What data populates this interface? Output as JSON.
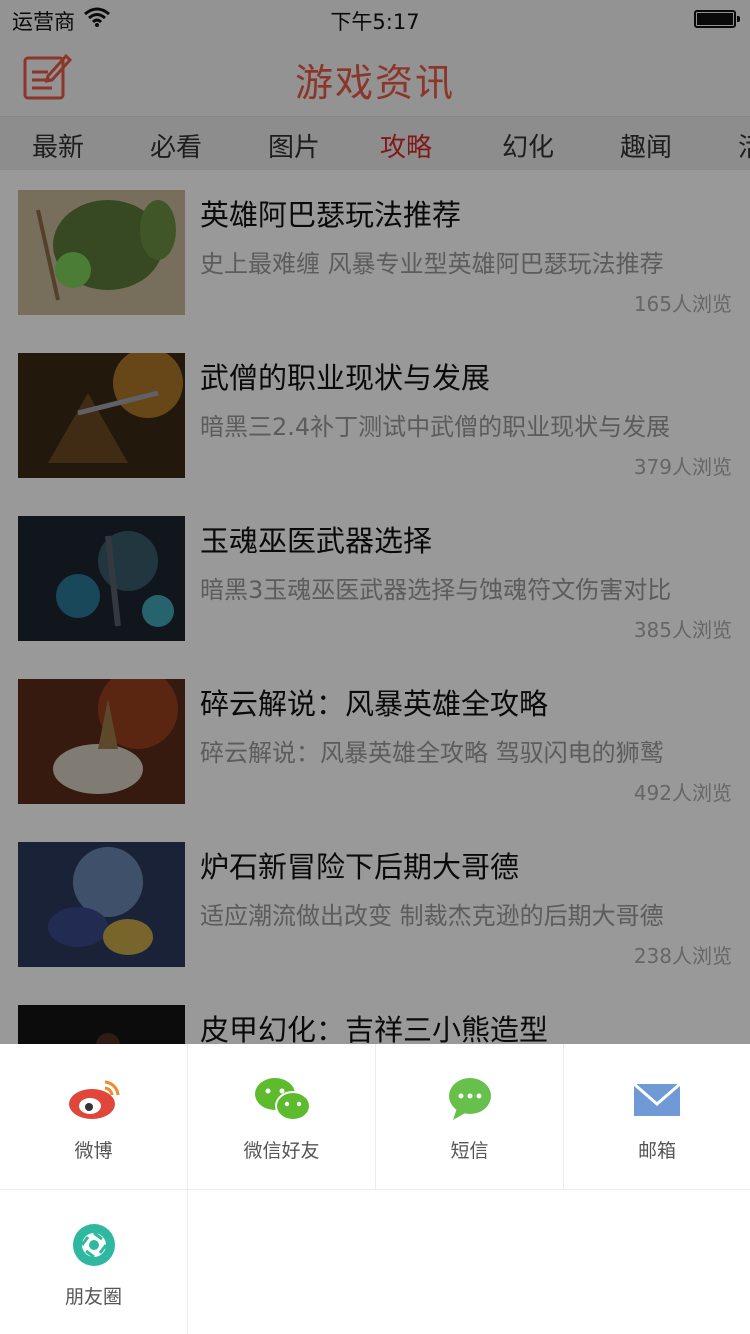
{
  "status_bar": {
    "carrier": "运营商",
    "time": "下午5:17",
    "battery_level": 1.0
  },
  "nav": {
    "title": "游戏资讯",
    "edit_icon": "edit-icon"
  },
  "tabs": [
    {
      "label": "最新",
      "active": false
    },
    {
      "label": "必看",
      "active": false
    },
    {
      "label": "图片",
      "active": false
    },
    {
      "label": "攻略",
      "active": true
    },
    {
      "label": "幻化",
      "active": false
    },
    {
      "label": "趣闻",
      "active": false
    },
    {
      "label": "活",
      "active": false
    }
  ],
  "articles": [
    {
      "title": "英雄阿巴瑟玩法推荐",
      "desc": "史上最难缠 风暴专业型英雄阿巴瑟玩法推荐",
      "views": "165人浏览"
    },
    {
      "title": "武僧的职业现状与发展",
      "desc": "暗黑三2.4补丁测试中武僧的职业现状与发展",
      "views": "379人浏览"
    },
    {
      "title": "玉魂巫医武器选择",
      "desc": "暗黑3玉魂巫医武器选择与蚀魂符文伤害对比",
      "views": "385人浏览"
    },
    {
      "title": "碎云解说：风暴英雄全攻略",
      "desc": "碎云解说：风暴英雄全攻略 驾驭闪电的狮鹫",
      "views": "492人浏览"
    },
    {
      "title": "炉石新冒险下后期大哥德",
      "desc": "适应潮流做出改变 制裁杰克逊的后期大哥德",
      "views": "238人浏览"
    },
    {
      "title": "皮甲幻化：吉祥三小熊造型",
      "desc": "",
      "views": ""
    }
  ],
  "share": [
    {
      "label": "微博",
      "icon": "weibo-icon"
    },
    {
      "label": "微信好友",
      "icon": "wechat-icon"
    },
    {
      "label": "短信",
      "icon": "sms-icon"
    },
    {
      "label": "邮箱",
      "icon": "mail-icon"
    },
    {
      "label": "朋友圈",
      "icon": "moments-icon"
    }
  ],
  "colors": {
    "accent": "#e85a48",
    "active_tab": "#d42a2a",
    "overlay": "rgba(0,0,0,0.4)"
  }
}
